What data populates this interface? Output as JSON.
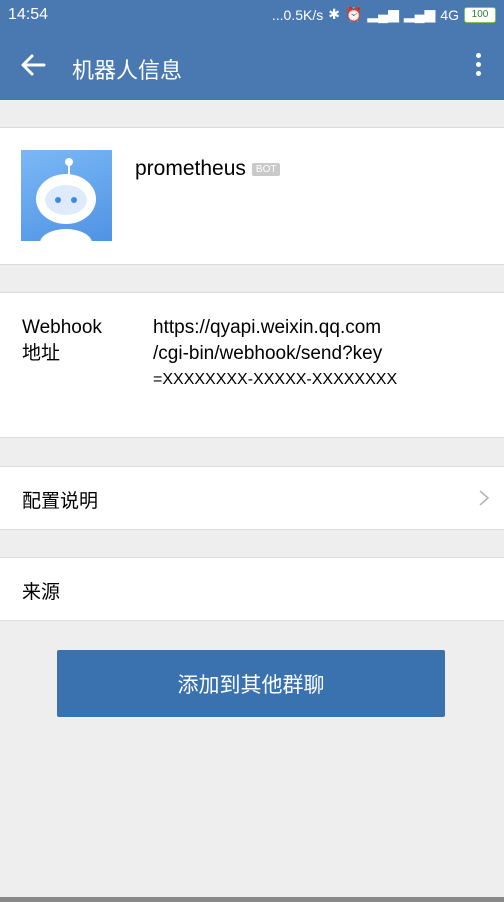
{
  "status_bar": {
    "time": "14:54",
    "network_speed": "...0.5K/s",
    "network_type": "4G",
    "battery": "100"
  },
  "app_bar": {
    "title": "机器人信息",
    "back_icon": "arrow-left-icon",
    "more_icon": "more-vertical-icon"
  },
  "bot": {
    "name": "prometheus",
    "badge": "BOT",
    "avatar_icon": "robot-avatar-icon"
  },
  "webhook": {
    "label_line1": "Webhook",
    "label_line2": "地址",
    "url_line1": "https://qyapi.weixin.qq.com",
    "url_line2": "/cgi-bin/webhook/send?key",
    "url_line3": "=XXXXXXXX-XXXXX-XXXXXXXX"
  },
  "rows": {
    "config_label": "配置说明",
    "source_label": "来源"
  },
  "action": {
    "add_to_group_label": "添加到其他群聊"
  },
  "colors": {
    "header": "#4a79b1",
    "button": "#3a72b0",
    "background": "#eeeeee"
  }
}
